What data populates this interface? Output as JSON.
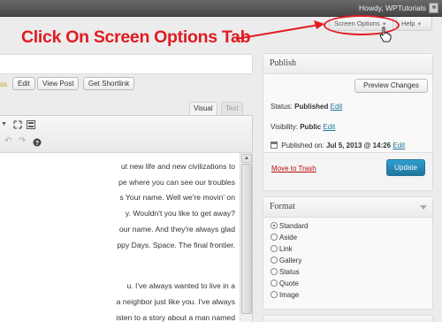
{
  "admin_bar": {
    "greeting": "Howdy, WPTutorials"
  },
  "screen_tabs": {
    "screen_options_label": "Screen Options",
    "help_label": "Help",
    "arrow": "▼"
  },
  "annotation": {
    "text": "Click On Screen Options Tab",
    "color": "#e11b22"
  },
  "permalink": {
    "slug_fragment": "ss",
    "buttons": [
      "Edit",
      "View Post",
      "Get Shortlink"
    ]
  },
  "editor": {
    "tabs": [
      "Visual",
      "Text"
    ],
    "active_tab": "Visual",
    "content_lines": [
      "ut new life and new civilizations to",
      "pe where you can see our troubles",
      "s Your name. Well we're movin' on",
      "y. Wouldn't you like to get away?",
      "our name. And they're always glad",
      "ppy Days. Space. The final frontier.",
      "",
      "",
      "u. I've always wanted to live in a",
      "a neighbor just like you. I've always",
      "isten to a story about a man named"
    ]
  },
  "publish": {
    "title": "Publish",
    "preview_label": "Preview Changes",
    "status_label": "Status:",
    "status_value": "Published",
    "visibility_label": "Visibility:",
    "visibility_value": "Public",
    "published_label": "Published on:",
    "published_value": "Jul 5, 2013 @ 14:26",
    "edit_label": "Edit",
    "trash_label": "Move to Trash",
    "update_label": "Update",
    "accent_color": "#21759b"
  },
  "format": {
    "title": "Format",
    "options": [
      "Standard",
      "Aside",
      "Link",
      "Gallery",
      "Status",
      "Quote",
      "Image"
    ],
    "selected": "Standard"
  }
}
